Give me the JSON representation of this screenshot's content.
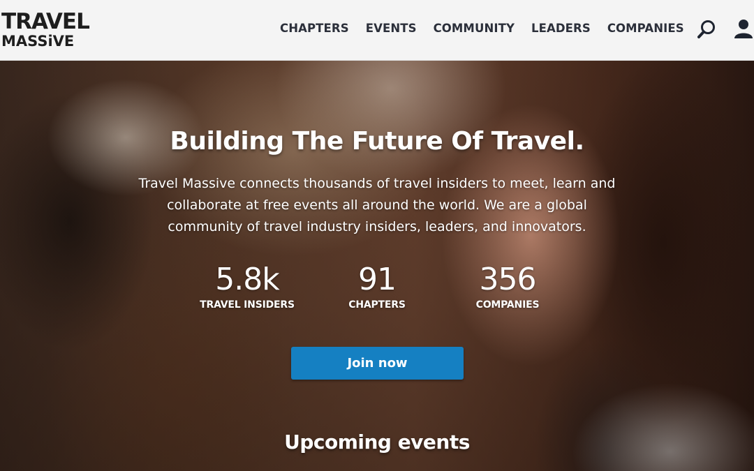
{
  "logo": {
    "line1": "TRAVEL",
    "line2": "MASSiVE"
  },
  "nav": {
    "items": [
      {
        "label": "CHAPTERS"
      },
      {
        "label": "EVENTS"
      },
      {
        "label": "COMMUNITY"
      },
      {
        "label": "LEADERS"
      },
      {
        "label": "COMPANIES"
      }
    ],
    "icons": [
      "search-icon",
      "user-icon"
    ]
  },
  "hero": {
    "headline": "Building The Future Of Travel.",
    "tagline": "Travel Massive connects thousands of travel insiders to meet, learn and collaborate at free events all around the world. We are a global community of travel industry insiders, leaders, and innovators.",
    "stats": [
      {
        "value": "5.8k",
        "label": "TRAVEL INSIDERS"
      },
      {
        "value": "91",
        "label": "CHAPTERS"
      },
      {
        "value": "356",
        "label": "COMPANIES"
      }
    ],
    "cta_label": "Join now",
    "section_title": "Upcoming events"
  },
  "colors": {
    "header_bg": "#f4f4f4",
    "nav_text": "#2b2f3a",
    "cta_bg": "#1580c2",
    "hero_text": "#ffffff"
  }
}
